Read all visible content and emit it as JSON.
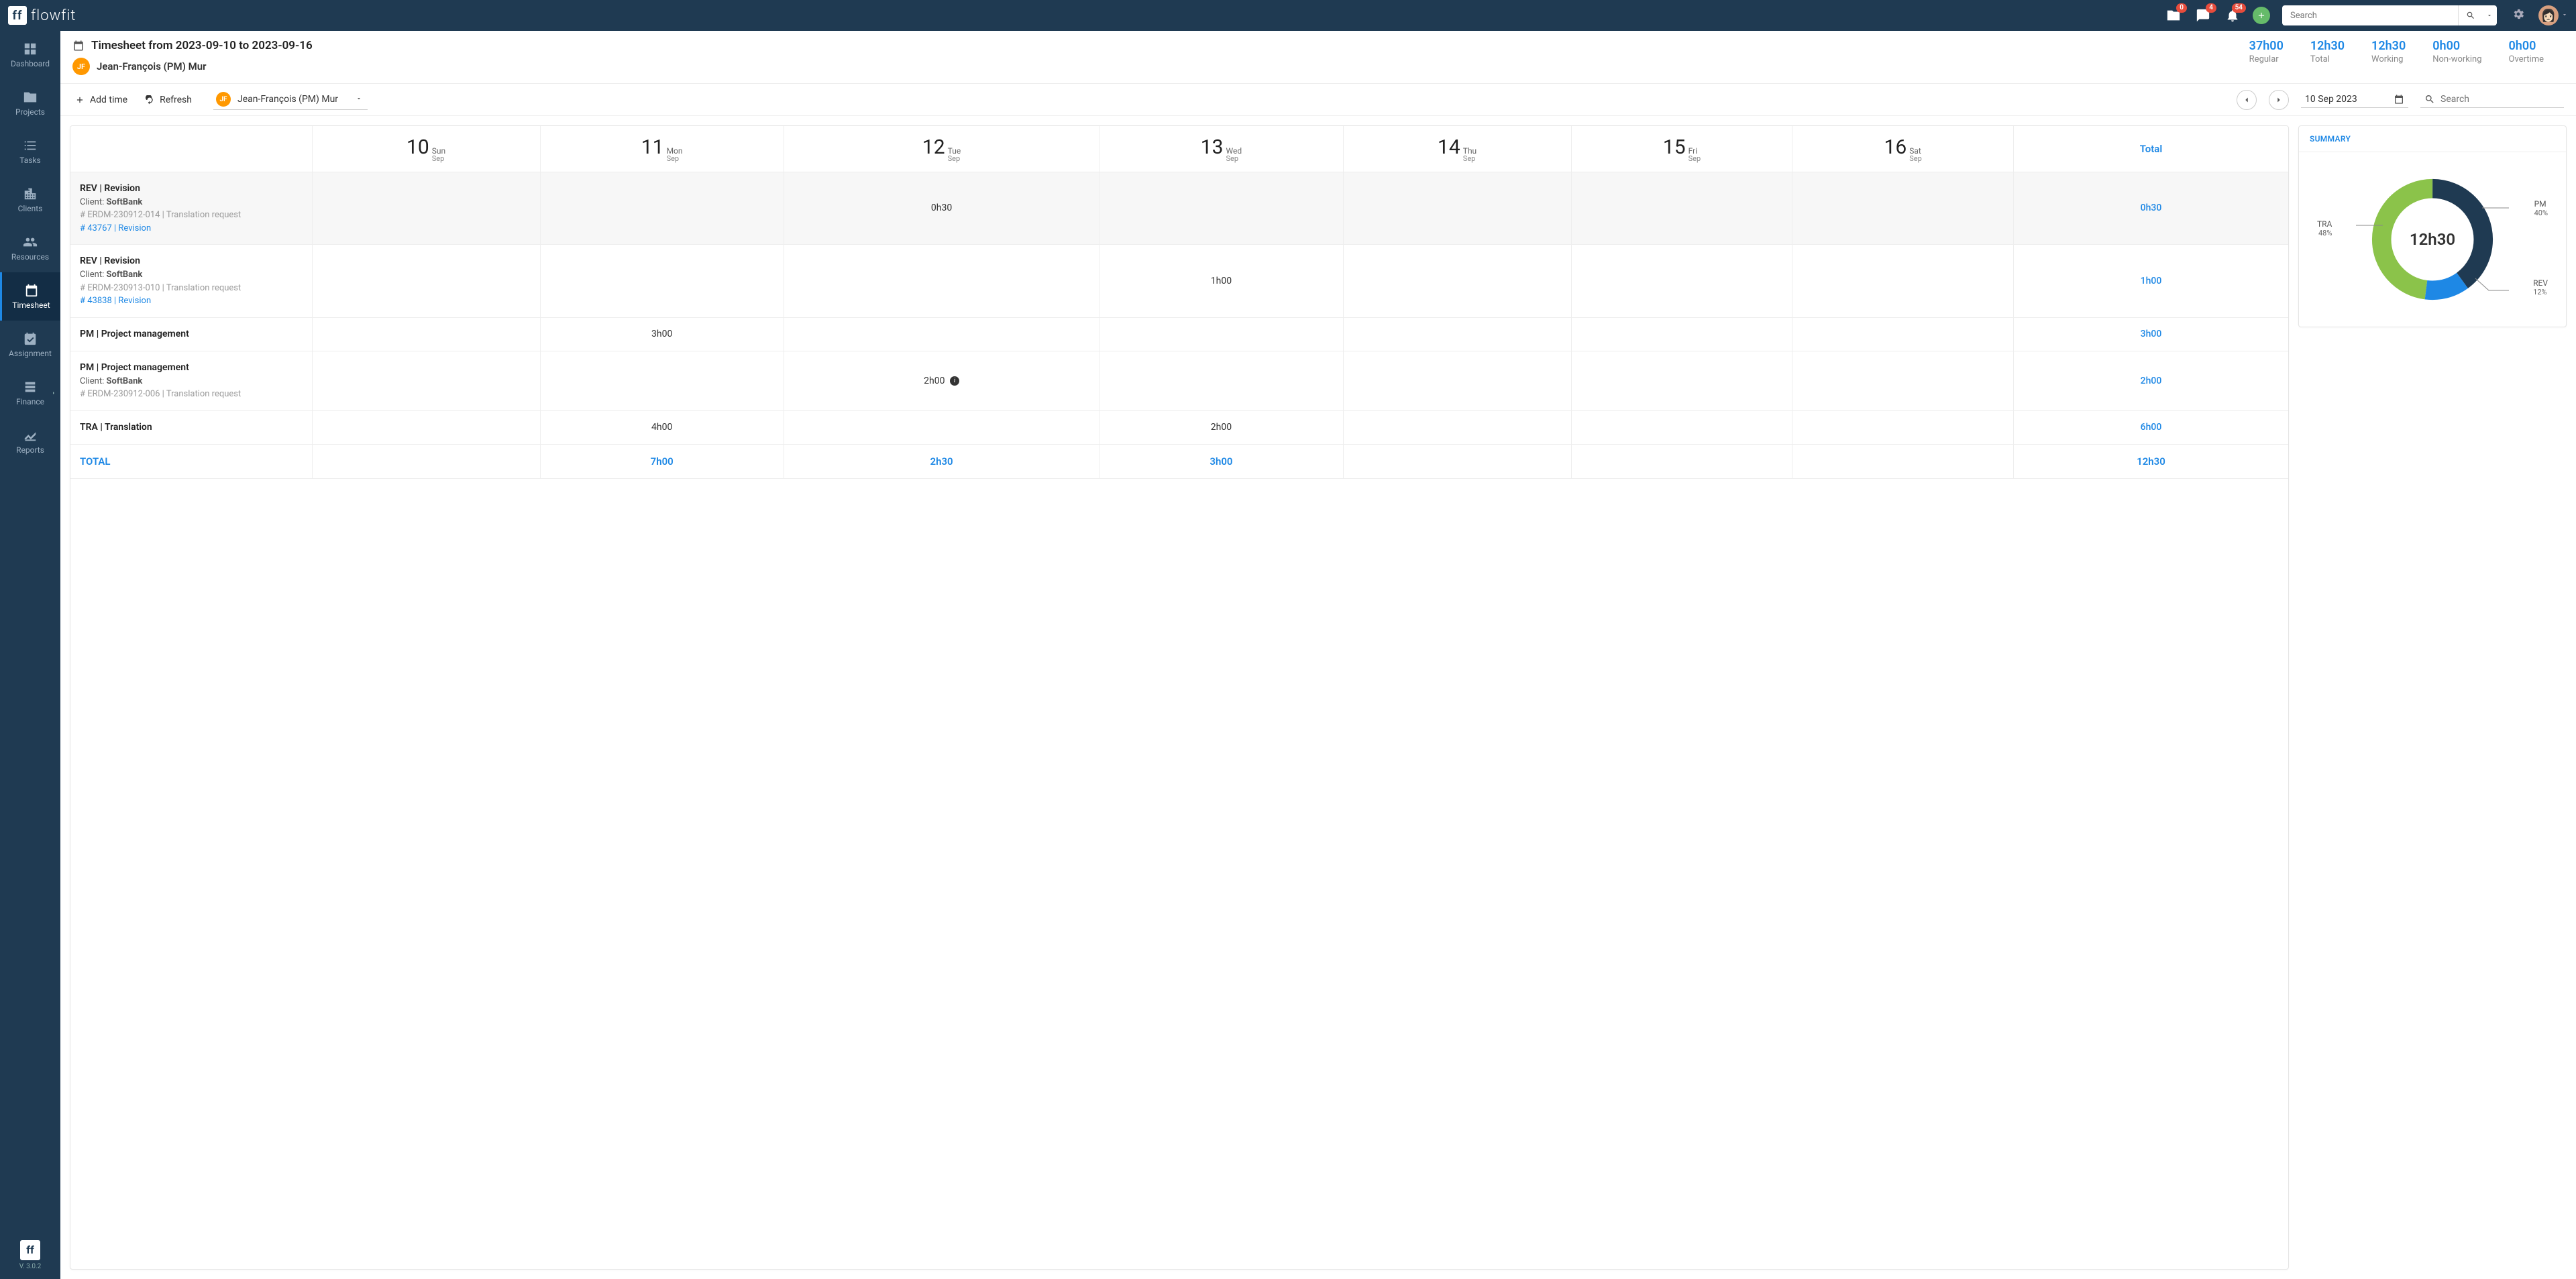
{
  "app": {
    "name": "flowfit",
    "logo_glyph": "ff",
    "version": "V. 3.0.2"
  },
  "topbar": {
    "badge_folder": "0",
    "badge_chat": "4",
    "badge_bell": "54",
    "search_placeholder": "Search"
  },
  "sidebar": {
    "items": [
      {
        "label": "Dashboard"
      },
      {
        "label": "Projects"
      },
      {
        "label": "Tasks"
      },
      {
        "label": "Clients"
      },
      {
        "label": "Resources"
      },
      {
        "label": "Timesheet"
      },
      {
        "label": "Assignment"
      },
      {
        "label": "Finance"
      },
      {
        "label": "Reports"
      }
    ]
  },
  "header": {
    "title": "Timesheet  from 2023-09-10 to 2023-09-16",
    "user_initials": "JF",
    "user_name": "Jean-François (PM) Mur",
    "stats": [
      {
        "value": "37h00",
        "label": "Regular"
      },
      {
        "value": "12h30",
        "label": "Total"
      },
      {
        "value": "12h30",
        "label": "Working"
      },
      {
        "value": "0h00",
        "label": "Non-working"
      },
      {
        "value": "0h00",
        "label": "Overtime"
      }
    ]
  },
  "toolbar": {
    "add_time": "Add time",
    "refresh": "Refresh",
    "selected_user": "Jean-François (PM) Mur",
    "date": "10 Sep 2023",
    "search_placeholder": "Search"
  },
  "table": {
    "total_col_head": "Total",
    "days": [
      {
        "num": "10",
        "dow": "Sun",
        "mon": "Sep"
      },
      {
        "num": "11",
        "dow": "Mon",
        "mon": "Sep"
      },
      {
        "num": "12",
        "dow": "Tue",
        "mon": "Sep"
      },
      {
        "num": "13",
        "dow": "Wed",
        "mon": "Sep"
      },
      {
        "num": "14",
        "dow": "Thu",
        "mon": "Sep"
      },
      {
        "num": "15",
        "dow": "Fri",
        "mon": "Sep"
      },
      {
        "num": "16",
        "dow": "Sat",
        "mon": "Sep"
      }
    ],
    "rows": [
      {
        "title": "REV | Revision",
        "client_label": "Client: ",
        "client": "SoftBank",
        "ref": "# ERDM-230912-014 | Translation request",
        "link": "# 43767 | Revision",
        "cells": [
          "",
          "",
          "0h30",
          "",
          "",
          "",
          ""
        ],
        "total": "0h30",
        "shaded": true,
        "note_idx": -1
      },
      {
        "title": "REV | Revision",
        "client_label": "Client: ",
        "client": "SoftBank",
        "ref": "# ERDM-230913-010 | Translation request",
        "link": "# 43838 | Revision",
        "cells": [
          "",
          "",
          "",
          "1h00",
          "",
          "",
          ""
        ],
        "total": "1h00",
        "shaded": false,
        "note_idx": -1
      },
      {
        "title": "PM | Project management",
        "client_label": "",
        "client": "",
        "ref": "",
        "link": "",
        "cells": [
          "",
          "3h00",
          "",
          "",
          "",
          "",
          ""
        ],
        "total": "3h00",
        "shaded": false,
        "note_idx": -1
      },
      {
        "title": "PM | Project management",
        "client_label": "Client: ",
        "client": "SoftBank",
        "ref": "# ERDM-230912-006 | Translation request",
        "link": "",
        "cells": [
          "",
          "",
          "2h00",
          "",
          "",
          "",
          ""
        ],
        "total": "2h00",
        "shaded": false,
        "note_idx": 2
      },
      {
        "title": "TRA | Translation",
        "client_label": "",
        "client": "",
        "ref": "",
        "link": "",
        "cells": [
          "",
          "4h00",
          "",
          "2h00",
          "",
          "",
          ""
        ],
        "total": "6h00",
        "shaded": false,
        "note_idx": -1
      }
    ],
    "total_row": {
      "label": "TOTAL",
      "cells": [
        "",
        "7h00",
        "2h30",
        "3h00",
        "",
        "",
        ""
      ],
      "total": "12h30"
    }
  },
  "summary": {
    "title": "SUMMARY",
    "center": "12h30",
    "segments": [
      {
        "label": "PM",
        "pct": "40%"
      },
      {
        "label": "REV",
        "pct": "12%"
      },
      {
        "label": "TRA",
        "pct": "48%"
      }
    ]
  },
  "chart_data": {
    "type": "pie",
    "title": "SUMMARY",
    "center_value": "12h30",
    "series": [
      {
        "name": "PM",
        "value": 40,
        "color": "#1f3a52"
      },
      {
        "name": "REV",
        "value": 12,
        "color": "#1e88e5"
      },
      {
        "name": "TRA",
        "value": 48,
        "color": "#8bc34a"
      }
    ],
    "unit": "percent"
  }
}
